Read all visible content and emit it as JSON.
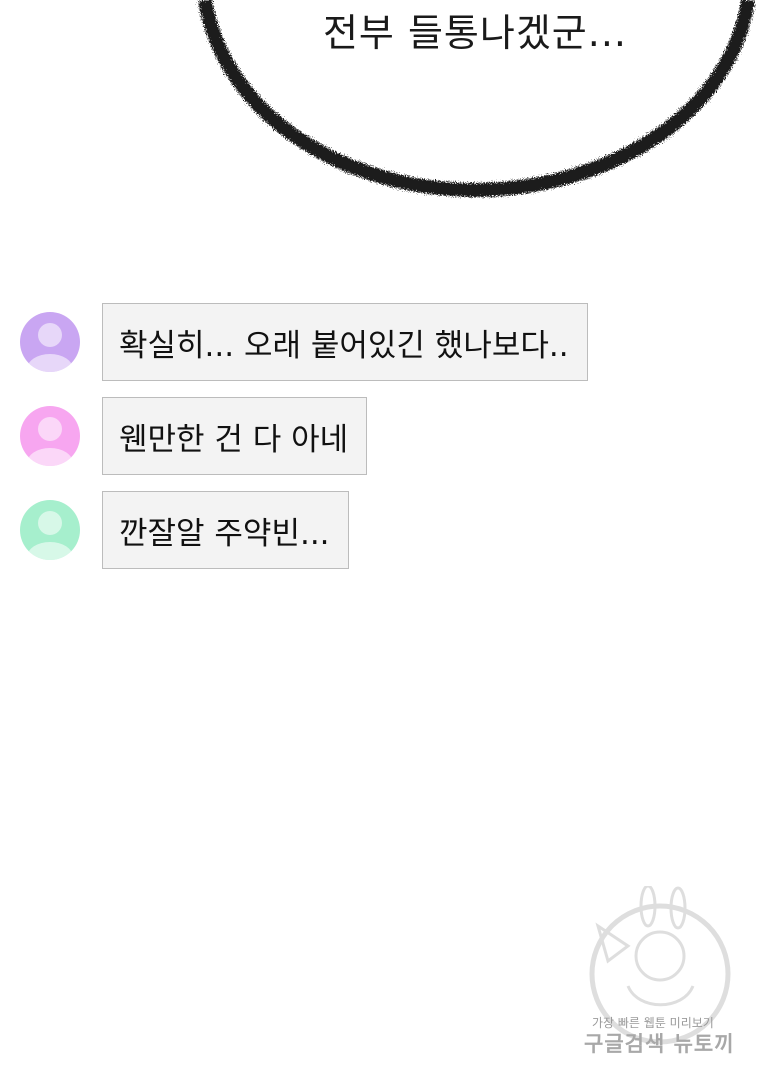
{
  "speech_bubble": {
    "text": "전부 들통나겠군..."
  },
  "chat": {
    "messages": [
      {
        "text": "확실히... 오래 붙어있긴 했나보다..",
        "avatar_color": "#c9a6f2"
      },
      {
        "text": "웬만한 건 다 아네",
        "avatar_color": "#f7a6f0"
      },
      {
        "text": "깐잘알 주약빈...",
        "avatar_color": "#a6efcd"
      }
    ]
  },
  "watermark": {
    "line1": "가장 빠른 웹툰 미리보기",
    "line2": "구글검색 뉴토끼"
  }
}
